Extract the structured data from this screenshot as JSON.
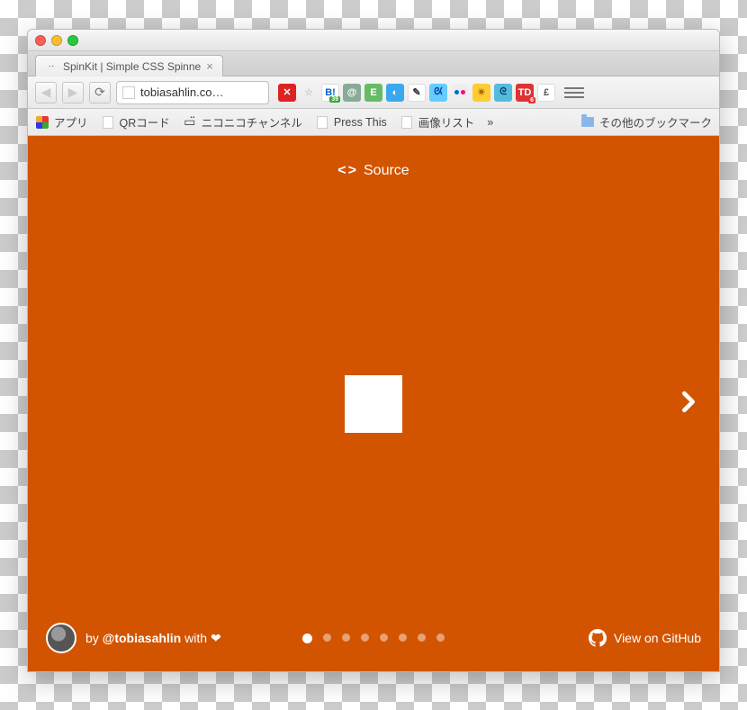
{
  "tab": {
    "title": "SpinKit | Simple CSS Spinne"
  },
  "omnibox": {
    "url": "tobiasahlin.co…"
  },
  "bookmarks": {
    "apps": "アプリ",
    "qr": "QRコード",
    "nico": "ニコニコチャンネル",
    "press": "Press This",
    "imglist": "画像リスト",
    "overflow": "»",
    "other": "その他のブックマーク"
  },
  "page": {
    "source_label": "Source",
    "byline_prefix": "by ",
    "byline_handle": "@tobiasahlin",
    "byline_with": " with ",
    "heart": "❤",
    "github_label": "View on GitHub",
    "pager": {
      "count": 8,
      "active": 0
    }
  },
  "colors": {
    "bg": "#d35400",
    "fg": "#ffffff"
  }
}
